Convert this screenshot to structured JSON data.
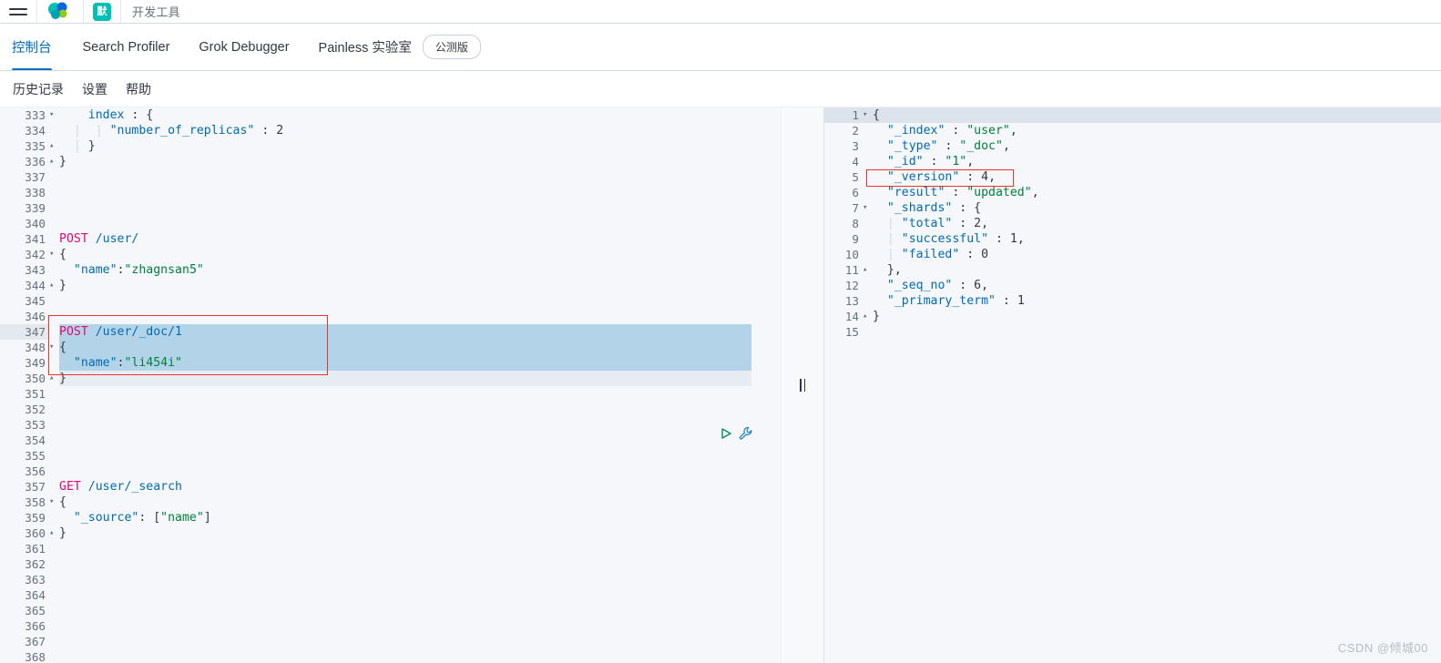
{
  "topbar": {
    "menu_icon": "hamburger-menu-icon",
    "logo_icon": "elastic-logo-icon",
    "space_badge": "默",
    "app_title": "开发工具"
  },
  "tabs": [
    {
      "label": "控制台",
      "active": true
    },
    {
      "label": "Search Profiler",
      "active": false
    },
    {
      "label": "Grok Debugger",
      "active": false
    },
    {
      "label": "Painless 实验室",
      "active": false,
      "badge": "公测版"
    }
  ],
  "submenu": [
    {
      "label": "历史记录"
    },
    {
      "label": "设置"
    },
    {
      "label": "帮助"
    }
  ],
  "editor": {
    "first_line": 333,
    "last_line": 368,
    "active_line": 347,
    "selection_start": 347,
    "selection_end": 350,
    "actions": {
      "play": "play-icon",
      "wrench": "wrench-icon"
    },
    "lines": [
      {
        "n": 333,
        "fold": "▾",
        "html": "<span class='indent-guide'>    </span><span class='t-key'>index</span><span class='t-punct'> : {</span>"
      },
      {
        "n": 334,
        "fold": "",
        "html": "<span class='indent-guide'>  |  | </span><span class='t-key'>\"number_of_replicas\"</span><span class='t-punct'> : </span><span class='t-num'>2</span>"
      },
      {
        "n": 335,
        "fold": "▴",
        "html": "<span class='indent-guide'>  | </span><span class='t-punct'>}</span>"
      },
      {
        "n": 336,
        "fold": "▴",
        "html": "<span class='t-punct'>}</span>"
      },
      {
        "n": 337,
        "fold": "",
        "html": ""
      },
      {
        "n": 338,
        "fold": "",
        "html": ""
      },
      {
        "n": 339,
        "fold": "",
        "html": ""
      },
      {
        "n": 340,
        "fold": "",
        "html": ""
      },
      {
        "n": 341,
        "fold": "",
        "html": "<span class='t-method'>POST</span><span class='t-url'> /user/</span>"
      },
      {
        "n": 342,
        "fold": "▾",
        "html": "<span class='t-punct'>{</span>"
      },
      {
        "n": 343,
        "fold": "",
        "html": "<span class='t-key'>  \"name\"</span><span class='t-punct'>:</span><span class='t-str'>\"zhagnsan5\"</span>"
      },
      {
        "n": 344,
        "fold": "▴",
        "html": "<span class='t-punct'>}</span>"
      },
      {
        "n": 345,
        "fold": "",
        "html": ""
      },
      {
        "n": 346,
        "fold": "",
        "html": ""
      },
      {
        "n": 347,
        "fold": "",
        "html": "<span class='t-method'>POST</span><span class='t-url'> /user/_doc/1</span>"
      },
      {
        "n": 348,
        "fold": "▾",
        "html": "<span class='t-punct'>{</span>"
      },
      {
        "n": 349,
        "fold": "",
        "html": "<span class='t-key'>  \"name\"</span><span class='t-punct'>:</span><span class='t-str'>\"li454i\"</span>"
      },
      {
        "n": 350,
        "fold": "▴",
        "html": "<span class='t-punct'>}</span>"
      },
      {
        "n": 351,
        "fold": "",
        "html": ""
      },
      {
        "n": 352,
        "fold": "",
        "html": ""
      },
      {
        "n": 353,
        "fold": "",
        "html": ""
      },
      {
        "n": 354,
        "fold": "",
        "html": ""
      },
      {
        "n": 355,
        "fold": "",
        "html": ""
      },
      {
        "n": 356,
        "fold": "",
        "html": ""
      },
      {
        "n": 357,
        "fold": "",
        "html": "<span class='t-method'>GET</span><span class='t-url'> /user/_search</span>"
      },
      {
        "n": 358,
        "fold": "▾",
        "html": "<span class='t-punct'>{</span>"
      },
      {
        "n": 359,
        "fold": "",
        "html": "<span class='t-key'>  \"_source\"</span><span class='t-punct'>: [</span><span class='t-str'>\"name\"</span><span class='t-punct'>]</span>"
      },
      {
        "n": 360,
        "fold": "▴",
        "html": "<span class='t-punct'>}</span>"
      },
      {
        "n": 361,
        "fold": "",
        "html": ""
      },
      {
        "n": 362,
        "fold": "",
        "html": ""
      },
      {
        "n": 363,
        "fold": "",
        "html": ""
      },
      {
        "n": 364,
        "fold": "",
        "html": ""
      },
      {
        "n": 365,
        "fold": "",
        "html": ""
      },
      {
        "n": 366,
        "fold": "",
        "html": ""
      },
      {
        "n": 367,
        "fold": "",
        "html": ""
      },
      {
        "n": 368,
        "fold": "",
        "html": ""
      }
    ]
  },
  "output": {
    "active_line": 1,
    "highlight_line": 5,
    "lines": [
      {
        "n": 1,
        "fold": "▾",
        "html": "<span class='t-punct'>{</span>"
      },
      {
        "n": 2,
        "fold": "",
        "html": "<span class='t-key'>  \"_index\"</span><span class='t-punct'> : </span><span class='t-str'>\"user\"</span><span class='t-punct'>,</span>"
      },
      {
        "n": 3,
        "fold": "",
        "html": "<span class='t-key'>  \"_type\"</span><span class='t-punct'> : </span><span class='t-str'>\"_doc\"</span><span class='t-punct'>,</span>"
      },
      {
        "n": 4,
        "fold": "",
        "html": "<span class='t-key'>  \"_id\"</span><span class='t-punct'> : </span><span class='t-str'>\"1\"</span><span class='t-punct'>,</span>"
      },
      {
        "n": 5,
        "fold": "",
        "html": "<span class='t-key'>  \"_version\"</span><span class='t-punct'> : </span><span class='t-num'>4</span><span class='t-punct'>,</span>"
      },
      {
        "n": 6,
        "fold": "",
        "html": "<span class='t-key'>  \"result\"</span><span class='t-punct'> : </span><span class='t-str'>\"updated\"</span><span class='t-punct'>,</span>"
      },
      {
        "n": 7,
        "fold": "▾",
        "html": "<span class='t-key'>  \"_shards\"</span><span class='t-punct'> : {</span>"
      },
      {
        "n": 8,
        "fold": "",
        "html": "<span class='indent-guide'>  | </span><span class='t-key'>\"total\"</span><span class='t-punct'> : </span><span class='t-num'>2</span><span class='t-punct'>,</span>"
      },
      {
        "n": 9,
        "fold": "",
        "html": "<span class='indent-guide'>  | </span><span class='t-key'>\"successful\"</span><span class='t-punct'> : </span><span class='t-num'>1</span><span class='t-punct'>,</span>"
      },
      {
        "n": 10,
        "fold": "",
        "html": "<span class='indent-guide'>  | </span><span class='t-key'>\"failed\"</span><span class='t-punct'> : </span><span class='t-num'>0</span>"
      },
      {
        "n": 11,
        "fold": "▴",
        "html": "<span class='t-punct'>  },</span>"
      },
      {
        "n": 12,
        "fold": "",
        "html": "<span class='t-key'>  \"_seq_no\"</span><span class='t-punct'> : </span><span class='t-num'>6</span><span class='t-punct'>,</span>"
      },
      {
        "n": 13,
        "fold": "",
        "html": "<span class='t-key'>  \"_primary_term\"</span><span class='t-punct'> : </span><span class='t-num'>1</span>"
      },
      {
        "n": 14,
        "fold": "▴",
        "html": "<span class='t-punct'>}</span>"
      },
      {
        "n": 15,
        "fold": "",
        "html": ""
      }
    ]
  },
  "annotations": {
    "request_box_label": "highlighted-request-region",
    "version_box_label": "highlighted-version-field"
  },
  "watermark": "CSDN @倾城00",
  "colors": {
    "accent": "#006bb4",
    "method": "#dd0a73",
    "string": "#00803d",
    "selection": "#b3d4e8",
    "annotation": "#e8342a",
    "brand_teal": "#00bfb3"
  }
}
